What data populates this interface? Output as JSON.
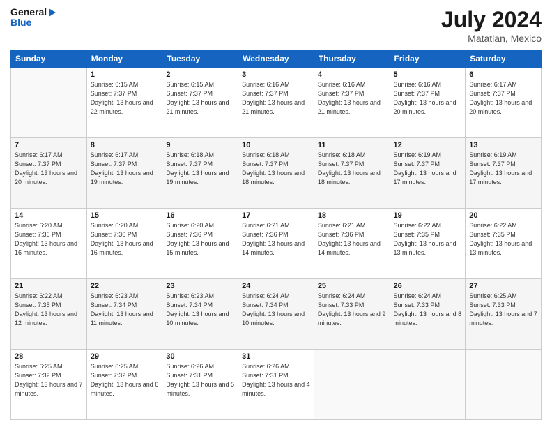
{
  "header": {
    "logo_general": "General",
    "logo_blue": "Blue",
    "title": "July 2024",
    "subtitle": "Matatlan, Mexico"
  },
  "days_of_week": [
    "Sunday",
    "Monday",
    "Tuesday",
    "Wednesday",
    "Thursday",
    "Friday",
    "Saturday"
  ],
  "weeks": [
    [
      {
        "day": "",
        "info": ""
      },
      {
        "day": "1",
        "info": "Sunrise: 6:15 AM\nSunset: 7:37 PM\nDaylight: 13 hours and 22 minutes."
      },
      {
        "day": "2",
        "info": "Sunrise: 6:15 AM\nSunset: 7:37 PM\nDaylight: 13 hours and 21 minutes."
      },
      {
        "day": "3",
        "info": "Sunrise: 6:16 AM\nSunset: 7:37 PM\nDaylight: 13 hours and 21 minutes."
      },
      {
        "day": "4",
        "info": "Sunrise: 6:16 AM\nSunset: 7:37 PM\nDaylight: 13 hours and 21 minutes."
      },
      {
        "day": "5",
        "info": "Sunrise: 6:16 AM\nSunset: 7:37 PM\nDaylight: 13 hours and 20 minutes."
      },
      {
        "day": "6",
        "info": "Sunrise: 6:17 AM\nSunset: 7:37 PM\nDaylight: 13 hours and 20 minutes."
      }
    ],
    [
      {
        "day": "7",
        "info": "Sunrise: 6:17 AM\nSunset: 7:37 PM\nDaylight: 13 hours and 20 minutes."
      },
      {
        "day": "8",
        "info": "Sunrise: 6:17 AM\nSunset: 7:37 PM\nDaylight: 13 hours and 19 minutes."
      },
      {
        "day": "9",
        "info": "Sunrise: 6:18 AM\nSunset: 7:37 PM\nDaylight: 13 hours and 19 minutes."
      },
      {
        "day": "10",
        "info": "Sunrise: 6:18 AM\nSunset: 7:37 PM\nDaylight: 13 hours and 18 minutes."
      },
      {
        "day": "11",
        "info": "Sunrise: 6:18 AM\nSunset: 7:37 PM\nDaylight: 13 hours and 18 minutes."
      },
      {
        "day": "12",
        "info": "Sunrise: 6:19 AM\nSunset: 7:37 PM\nDaylight: 13 hours and 17 minutes."
      },
      {
        "day": "13",
        "info": "Sunrise: 6:19 AM\nSunset: 7:37 PM\nDaylight: 13 hours and 17 minutes."
      }
    ],
    [
      {
        "day": "14",
        "info": "Sunrise: 6:20 AM\nSunset: 7:36 PM\nDaylight: 13 hours and 16 minutes."
      },
      {
        "day": "15",
        "info": "Sunrise: 6:20 AM\nSunset: 7:36 PM\nDaylight: 13 hours and 16 minutes."
      },
      {
        "day": "16",
        "info": "Sunrise: 6:20 AM\nSunset: 7:36 PM\nDaylight: 13 hours and 15 minutes."
      },
      {
        "day": "17",
        "info": "Sunrise: 6:21 AM\nSunset: 7:36 PM\nDaylight: 13 hours and 14 minutes."
      },
      {
        "day": "18",
        "info": "Sunrise: 6:21 AM\nSunset: 7:36 PM\nDaylight: 13 hours and 14 minutes."
      },
      {
        "day": "19",
        "info": "Sunrise: 6:22 AM\nSunset: 7:35 PM\nDaylight: 13 hours and 13 minutes."
      },
      {
        "day": "20",
        "info": "Sunrise: 6:22 AM\nSunset: 7:35 PM\nDaylight: 13 hours and 13 minutes."
      }
    ],
    [
      {
        "day": "21",
        "info": "Sunrise: 6:22 AM\nSunset: 7:35 PM\nDaylight: 13 hours and 12 minutes."
      },
      {
        "day": "22",
        "info": "Sunrise: 6:23 AM\nSunset: 7:34 PM\nDaylight: 13 hours and 11 minutes."
      },
      {
        "day": "23",
        "info": "Sunrise: 6:23 AM\nSunset: 7:34 PM\nDaylight: 13 hours and 10 minutes."
      },
      {
        "day": "24",
        "info": "Sunrise: 6:24 AM\nSunset: 7:34 PM\nDaylight: 13 hours and 10 minutes."
      },
      {
        "day": "25",
        "info": "Sunrise: 6:24 AM\nSunset: 7:33 PM\nDaylight: 13 hours and 9 minutes."
      },
      {
        "day": "26",
        "info": "Sunrise: 6:24 AM\nSunset: 7:33 PM\nDaylight: 13 hours and 8 minutes."
      },
      {
        "day": "27",
        "info": "Sunrise: 6:25 AM\nSunset: 7:33 PM\nDaylight: 13 hours and 7 minutes."
      }
    ],
    [
      {
        "day": "28",
        "info": "Sunrise: 6:25 AM\nSunset: 7:32 PM\nDaylight: 13 hours and 7 minutes."
      },
      {
        "day": "29",
        "info": "Sunrise: 6:25 AM\nSunset: 7:32 PM\nDaylight: 13 hours and 6 minutes."
      },
      {
        "day": "30",
        "info": "Sunrise: 6:26 AM\nSunset: 7:31 PM\nDaylight: 13 hours and 5 minutes."
      },
      {
        "day": "31",
        "info": "Sunrise: 6:26 AM\nSunset: 7:31 PM\nDaylight: 13 hours and 4 minutes."
      },
      {
        "day": "",
        "info": ""
      },
      {
        "day": "",
        "info": ""
      },
      {
        "day": "",
        "info": ""
      }
    ]
  ]
}
